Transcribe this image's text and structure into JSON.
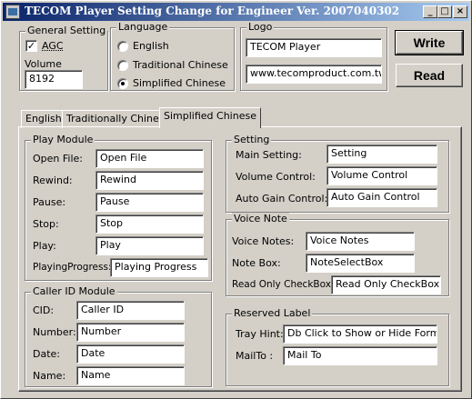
{
  "window": {
    "title": "TECOM Player Setting Change for Engineer Ver. 2007040302",
    "minimize": "_",
    "maximize": "□",
    "close": "×"
  },
  "general": {
    "label": "General Setting",
    "agc_label": "AGC",
    "agc_checked": true,
    "volume_label": "Volume",
    "volume_value": "8192"
  },
  "language": {
    "label": "Language",
    "options": [
      "English",
      "Traditional Chinese",
      "Simplified Chinese"
    ],
    "selected": "Simplified Chinese"
  },
  "logo": {
    "label": "Logo",
    "name": "TECOM Player",
    "url": "www.tecomproduct.com.tw"
  },
  "buttons": {
    "write": "Write",
    "read": "Read"
  },
  "tabs": [
    "English",
    "Traditionally Chinese",
    "Simplified Chinese"
  ],
  "active_tab": "Simplified Chinese",
  "play_module": {
    "label": "Play Module",
    "rows": [
      {
        "label": "Open File:",
        "value": "Open File"
      },
      {
        "label": "Rewind:",
        "value": "Rewind"
      },
      {
        "label": "Pause:",
        "value": "Pause"
      },
      {
        "label": "Stop:",
        "value": "Stop"
      },
      {
        "label": "Play:",
        "value": "Play"
      },
      {
        "label": "PlayingProgress:",
        "value": "Playing Progress"
      }
    ]
  },
  "caller_id": {
    "label": "Caller ID Module",
    "rows": [
      {
        "label": "CID:",
        "value": "Caller ID"
      },
      {
        "label": "Number:",
        "value": "Number"
      },
      {
        "label": "Date:",
        "value": "Date"
      },
      {
        "label": "Name:",
        "value": "Name"
      }
    ]
  },
  "setting": {
    "label": "Setting",
    "rows": [
      {
        "label": "Main Setting:",
        "value": "Setting"
      },
      {
        "label": "Volume Control:",
        "value": "Volume Control"
      },
      {
        "label": "Auto Gain Control:",
        "value": "Auto Gain Control"
      }
    ]
  },
  "voice_note": {
    "label": "Voice Note",
    "rows": [
      {
        "label": "Voice Notes:",
        "value": "Voice Notes"
      },
      {
        "label": "Note Box:",
        "value": "NoteSelectBox"
      },
      {
        "label": "Read Only CheckBox:",
        "value": "Read Only CheckBox"
      }
    ]
  },
  "reserved": {
    "label": "Reserved Label",
    "rows": [
      {
        "label": "Tray Hint:",
        "value": "Db Click to Show or Hide Form"
      },
      {
        "label": "MailTo :",
        "value": "Mail To"
      }
    ]
  }
}
